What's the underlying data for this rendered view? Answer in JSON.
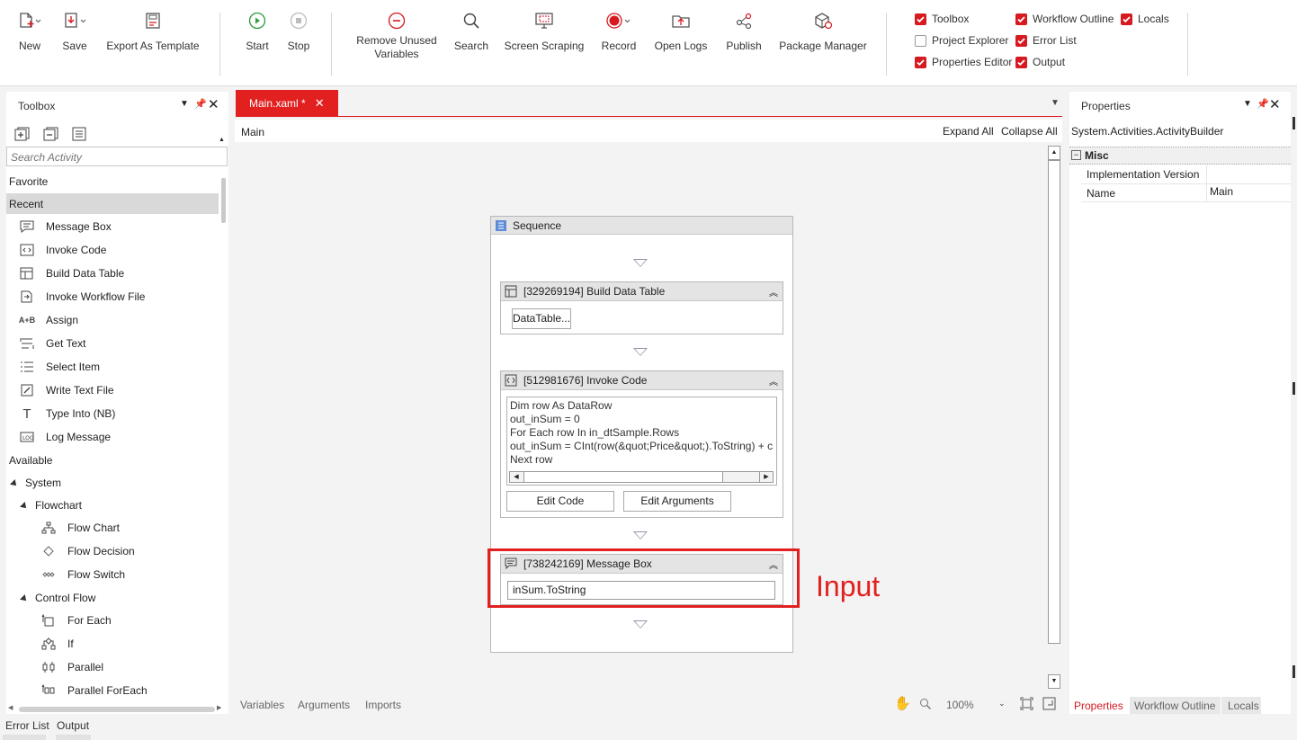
{
  "ribbon": {
    "new": "New",
    "save": "Save",
    "export_template": "Export As Template",
    "start": "Start",
    "stop": "Stop",
    "remove_unused_line1": "Remove Unused",
    "remove_unused_line2": "Variables",
    "search": "Search",
    "screen_scraping": "Screen Scraping",
    "record": "Record",
    "open_logs": "Open Logs",
    "publish": "Publish",
    "package_manager": "Package Manager",
    "toggles": {
      "toolbox": "Toolbox",
      "workflow_outline": "Workflow Outline",
      "locals": "Locals",
      "project_explorer": "Project Explorer",
      "error_list": "Error List",
      "properties_editor": "Properties Editor",
      "output": "Output"
    },
    "toggle_states": {
      "toolbox": true,
      "workflow_outline": true,
      "locals": true,
      "project_explorer": false,
      "error_list": true,
      "properties_editor": true,
      "output": true
    }
  },
  "toolbox": {
    "title": "Toolbox",
    "search_placeholder": "Search Activity",
    "favorite": "Favorite",
    "recent": "Recent",
    "recent_items": [
      "Message Box",
      "Invoke Code",
      "Build Data Table",
      "Invoke Workflow File",
      "Assign",
      "Get Text",
      "Select Item",
      "Write Text File",
      "Type Into (NB)",
      "Log Message"
    ],
    "available": "Available",
    "system": "System",
    "flowchart": "Flowchart",
    "flowchart_items": [
      "Flow Chart",
      "Flow Decision",
      "Flow Switch"
    ],
    "control_flow": "Control Flow",
    "control_flow_items": [
      "For Each",
      "If",
      "Parallel",
      "Parallel ForEach"
    ]
  },
  "designer": {
    "tab_label": "Main.xaml *",
    "breadcrumb": "Main",
    "expand_all": "Expand All",
    "collapse_all": "Collapse All",
    "sequence_title": "Sequence",
    "build_dt_title": "[329269194] Build Data Table",
    "build_dt_button": "DataTable...",
    "invoke_code_title": "[512981676] Invoke Code",
    "code_lines": [
      "Dim row As DataRow",
      "out_inSum = 0",
      "For Each row In in_dtSample.Rows",
      "out_inSum = CInt(row(&quot;Price&quot;).ToString) + c",
      "Next row"
    ],
    "edit_code": "Edit Code",
    "edit_arguments": "Edit Arguments",
    "msgbox_title": "[738242169] Message Box",
    "msgbox_value": "inSum.ToString",
    "annotation": "Input",
    "bottom_tabs": [
      "Variables",
      "Arguments",
      "Imports"
    ],
    "zoom": "100%"
  },
  "properties": {
    "title": "Properties",
    "object": "System.Activities.ActivityBuilder",
    "category": "Misc",
    "rows": [
      {
        "name": "Implementation Version",
        "value": ""
      },
      {
        "name": "Name",
        "value": "Main"
      }
    ],
    "tabs": [
      "Properties",
      "Workflow Outline",
      "Locals"
    ]
  },
  "bottom": {
    "error_list": "Error List",
    "output": "Output"
  },
  "colors": {
    "accent": "#d71920",
    "annotation": "#e1201f"
  }
}
